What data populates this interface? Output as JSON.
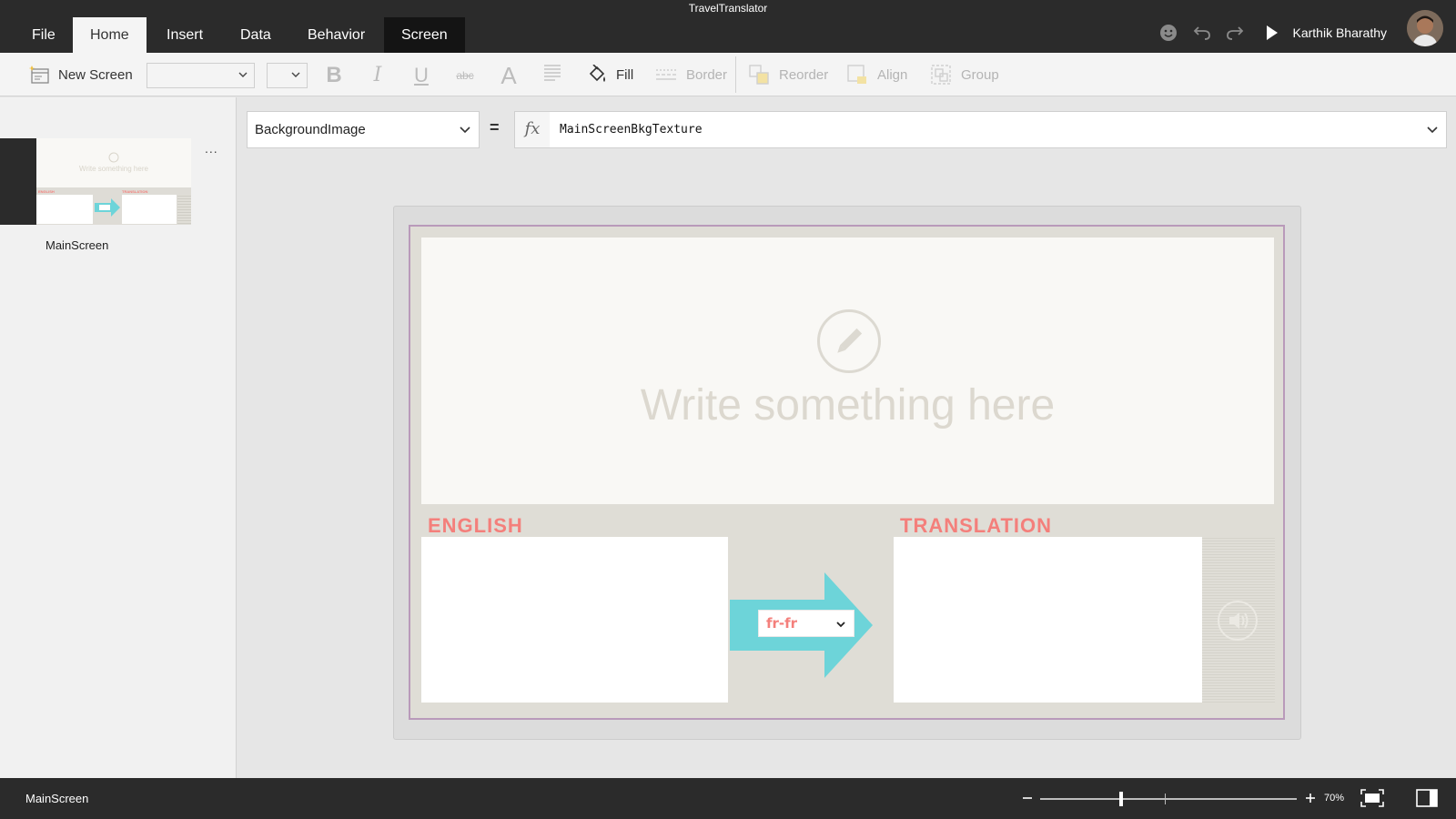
{
  "app": {
    "title": "TravelTranslator"
  },
  "menu": {
    "tabs": [
      {
        "label": "File"
      },
      {
        "label": "Home",
        "active": true
      },
      {
        "label": "Insert"
      },
      {
        "label": "Data"
      },
      {
        "label": "Behavior"
      },
      {
        "label": "Screen",
        "contextual": true
      }
    ]
  },
  "titlebar": {
    "user_name": "Karthik Bharathy",
    "icons": [
      "smiley-icon",
      "undo-icon",
      "redo-icon",
      "play-icon"
    ]
  },
  "ribbon": {
    "new_screen": "New Screen",
    "font_select": "",
    "size_select": "",
    "bold": "B",
    "italic": "I",
    "underline": "U",
    "strikethrough": "abc",
    "font_color": "A",
    "fill": "Fill",
    "border": "Border",
    "reorder": "Reorder",
    "align": "Align",
    "group": "Group"
  },
  "screens_panel": {
    "screens": [
      {
        "name": "MainScreen",
        "selected": true
      }
    ],
    "more_label": "..."
  },
  "formula_bar": {
    "property": "BackgroundImage",
    "equals": "=",
    "fx": "fx",
    "formula": "MainScreenBkgTexture"
  },
  "canvas": {
    "write_placeholder": "Write something here",
    "source_label": "ENGLISH",
    "target_label": "TRANSLATION",
    "language_selected": "fr-fr",
    "arrow_color": "#6dd4d9",
    "accent_color": "#f47f7b"
  },
  "status": {
    "screen_name": "MainScreen",
    "zoom": "70%",
    "zoom_value": 70
  }
}
